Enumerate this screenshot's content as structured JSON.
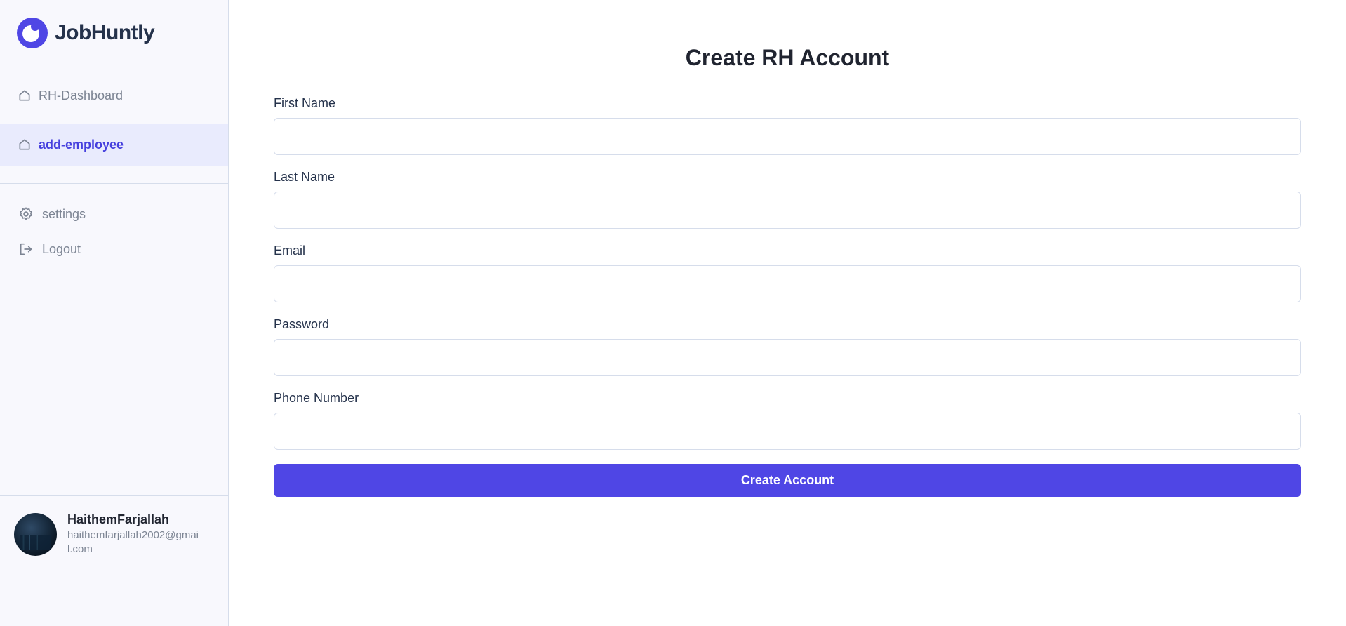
{
  "brand": {
    "name": "JobHuntly",
    "color": "#4f46e5"
  },
  "sidebar": {
    "items": [
      {
        "label": "RH-Dashboard",
        "icon": "home-icon",
        "active": false
      },
      {
        "label": "add-employee",
        "icon": "home-icon",
        "active": true
      }
    ],
    "secondary_items": [
      {
        "label": "settings",
        "icon": "gear-icon"
      },
      {
        "label": "Logout",
        "icon": "logout-icon"
      }
    ]
  },
  "user": {
    "name": "HaithemFarjallah",
    "email": "haithemfarjallah2002@gmail.com"
  },
  "page": {
    "title": "Create RH Account"
  },
  "form": {
    "fields": [
      {
        "label": "First Name",
        "value": ""
      },
      {
        "label": "Last Name",
        "value": ""
      },
      {
        "label": "Email",
        "value": ""
      },
      {
        "label": "Password",
        "value": ""
      },
      {
        "label": "Phone Number",
        "value": ""
      }
    ],
    "submit_label": "Create Account"
  },
  "colors": {
    "accent": "#4f46e5",
    "active_nav_bg": "#e9ebfd",
    "active_nav_text": "#4640de",
    "sidebar_bg": "#f8f8fd",
    "border": "#d6ddeb"
  }
}
